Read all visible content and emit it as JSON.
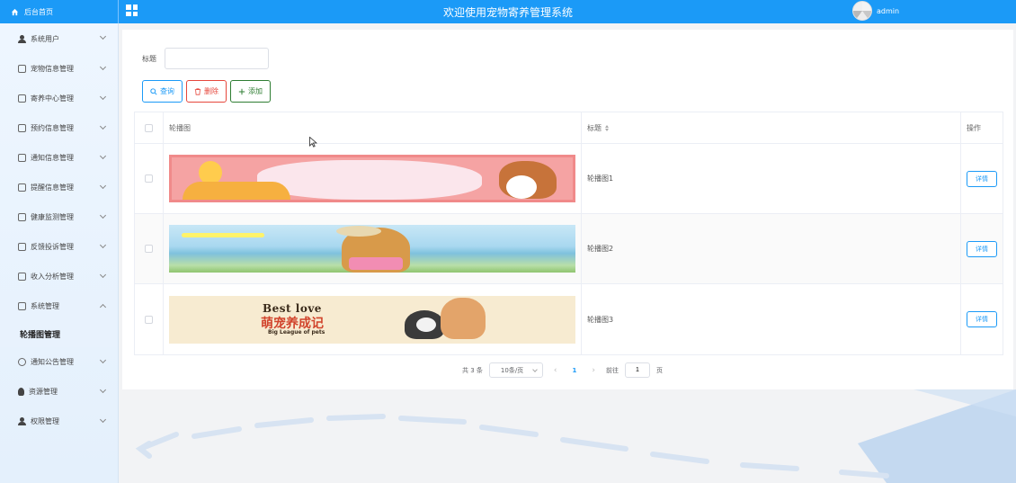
{
  "header": {
    "home_label": "后台首页",
    "title": "欢迎使用宠物寄养管理系统",
    "username": "admin"
  },
  "sidebar": {
    "items": [
      {
        "label": "系统用户",
        "icon": "user-icon"
      },
      {
        "label": "宠物信息管理",
        "icon": "document-icon"
      },
      {
        "label": "寄养中心管理",
        "icon": "document-icon"
      },
      {
        "label": "预约信息管理",
        "icon": "document-icon"
      },
      {
        "label": "通知信息管理",
        "icon": "document-icon"
      },
      {
        "label": "提醒信息管理",
        "icon": "document-icon"
      },
      {
        "label": "健康监测管理",
        "icon": "document-icon"
      },
      {
        "label": "反馈投诉管理",
        "icon": "document-icon"
      },
      {
        "label": "收入分析管理",
        "icon": "document-icon"
      },
      {
        "label": "系统管理",
        "icon": "picture-icon",
        "expanded": true
      }
    ],
    "sub_item": "轮播图管理",
    "items_after": [
      {
        "label": "通知公告管理",
        "icon": "info-icon"
      },
      {
        "label": "资源管理",
        "icon": "bulb-icon"
      },
      {
        "label": "权限管理",
        "icon": "user-icon"
      }
    ]
  },
  "search": {
    "label": "标题",
    "value": "",
    "placeholder": ""
  },
  "actions": {
    "query": "查询",
    "delete": "删除",
    "add": "添加"
  },
  "table": {
    "headers": {
      "image": "轮播图",
      "title": "标题",
      "operation": "操作"
    },
    "rows": [
      {
        "title": "轮播图1",
        "action": "详情"
      },
      {
        "title": "轮播图2",
        "action": "详情"
      },
      {
        "title": "轮播图3",
        "action": "详情",
        "banner_text": {
          "line1": "Best love",
          "line2": "萌宠养成记",
          "line3": "Big League of pets"
        }
      }
    ]
  },
  "pagination": {
    "total": "共 3 条",
    "page_size": "10条/页",
    "current_page": "1",
    "goto_label": "前往",
    "goto_value": "1",
    "page_suffix": "页"
  },
  "colors": {
    "primary": "#1b9af7",
    "danger": "#e6473c",
    "success": "#2e7d32"
  }
}
